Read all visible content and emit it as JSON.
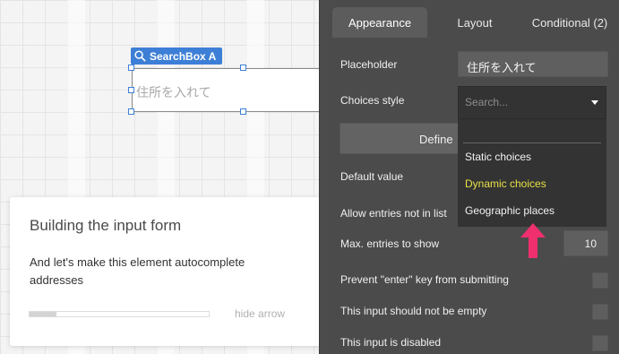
{
  "canvas": {
    "element_tag": "SearchBox A",
    "element_placeholder": "住所を入れて"
  },
  "tutorial": {
    "title": "Building the input form",
    "body": "And let's make this element autocomplete addresses",
    "progress": 0.15,
    "hide_label": "hide arrow"
  },
  "panel": {
    "tabs": [
      {
        "label": "Appearance",
        "active": true
      },
      {
        "label": "Layout",
        "active": false
      },
      {
        "label": "Conditional (2)",
        "active": false
      }
    ],
    "placeholder_label": "Placeholder",
    "placeholder_value": "住所を入れて",
    "choices_style_label": "Choices style",
    "define_button": "Define",
    "default_value_label": "Default value",
    "allow_entries_label": "Allow entries not in list",
    "max_entries_label": "Max. entries to show",
    "max_entries_value": "10",
    "prevent_enter_label": "Prevent \"enter\" key from submitting",
    "not_empty_label": "This input should not be empty",
    "disabled_label": "This input is disabled"
  },
  "dropdown": {
    "search_placeholder": "Search...",
    "options": [
      "Static choices",
      "Dynamic choices",
      "Geographic places"
    ],
    "highlighted": "Dynamic choices"
  },
  "colors": {
    "accent_blue": "#3d7fd6",
    "highlight_yellow": "#e8e048",
    "arrow_pink": "#ef2f6e"
  }
}
